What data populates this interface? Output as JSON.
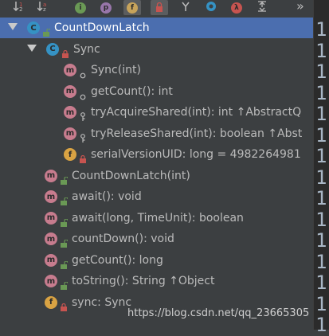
{
  "toolbar": {
    "buttons": [
      {
        "name": "sort-type-icon",
        "active": false
      },
      {
        "name": "sort-alpha-icon",
        "active": false
      },
      {
        "name": "show-interfaces-icon",
        "badge": "i",
        "color": "#6a9955",
        "active": false
      },
      {
        "name": "show-properties-icon",
        "badge": "p",
        "color": "#9876aa",
        "active": false
      },
      {
        "name": "show-fields-icon",
        "badge": "f",
        "color": "#c7a35b",
        "active": true
      },
      {
        "name": "show-non-public-icon",
        "active": true
      },
      {
        "name": "show-inherited-icon",
        "active": false
      },
      {
        "name": "show-anonymous-icon",
        "active": false
      },
      {
        "name": "show-lambdas-icon",
        "badge": "λ",
        "color": "#c75450",
        "active": false
      },
      {
        "name": "expand-all-icon",
        "active": false
      }
    ],
    "overflow": "»"
  },
  "tree": {
    "rows": [
      {
        "indent": 0,
        "toggle": true,
        "icon": "class",
        "badge": "C",
        "vis": "public",
        "label": "CountDownLatch",
        "selected": true
      },
      {
        "indent": 1,
        "toggle": true,
        "icon": "class",
        "badge": "C",
        "vis": "private",
        "label": "Sync",
        "selected": false
      },
      {
        "indent": 2,
        "toggle": false,
        "icon": "method",
        "badge": "m",
        "vis": "package",
        "label": "Sync(int)",
        "selected": false
      },
      {
        "indent": 2,
        "toggle": false,
        "icon": "method",
        "badge": "m",
        "vis": "package",
        "label": "getCount(): int",
        "selected": false
      },
      {
        "indent": 2,
        "toggle": false,
        "icon": "method",
        "badge": "m",
        "vis": "protected",
        "label": "tryAcquireShared(int): int ↑AbstractQ",
        "selected": false
      },
      {
        "indent": 2,
        "toggle": false,
        "icon": "method",
        "badge": "m",
        "vis": "protected",
        "label": "tryReleaseShared(int): boolean ↑Abst",
        "selected": false
      },
      {
        "indent": 2,
        "toggle": false,
        "icon": "field",
        "badge": "f",
        "vis": "private",
        "label": "serialVersionUID: long = 4982264981",
        "selected": false
      },
      {
        "indent": 1,
        "toggle": false,
        "icon": "method",
        "badge": "m",
        "vis": "public",
        "label": "CountDownLatch(int)",
        "selected": false
      },
      {
        "indent": 1,
        "toggle": false,
        "icon": "method",
        "badge": "m",
        "vis": "public",
        "label": "await(): void",
        "selected": false
      },
      {
        "indent": 1,
        "toggle": false,
        "icon": "method",
        "badge": "m",
        "vis": "public",
        "label": "await(long, TimeUnit): boolean",
        "selected": false
      },
      {
        "indent": 1,
        "toggle": false,
        "icon": "method",
        "badge": "m",
        "vis": "public",
        "label": "countDown(): void",
        "selected": false
      },
      {
        "indent": 1,
        "toggle": false,
        "icon": "method",
        "badge": "m",
        "vis": "public",
        "label": "getCount(): long",
        "selected": false
      },
      {
        "indent": 1,
        "toggle": false,
        "icon": "method",
        "badge": "m",
        "vis": "public",
        "label": "toString(): String ↑Object",
        "selected": false
      },
      {
        "indent": 1,
        "toggle": false,
        "icon": "field",
        "badge": "f",
        "vis": "private",
        "label": "sync: Sync",
        "selected": false
      }
    ]
  },
  "gutter": {
    "line_numbers": [
      "1",
      "1",
      "1",
      "1",
      "1",
      "1",
      "1",
      "1",
      "1",
      "1",
      "1",
      "1",
      "1",
      "1",
      "1"
    ]
  },
  "watermark": "https://blog.csdn.net/qq_23665305",
  "colors": {
    "background": "#3c3f41",
    "selection": "#4b6eaf",
    "method_badge": "#c77c8e",
    "class_badge": "#3592c4",
    "field_badge": "#d9a343",
    "public_vis": "#6a9955",
    "private_vis": "#c75450"
  }
}
